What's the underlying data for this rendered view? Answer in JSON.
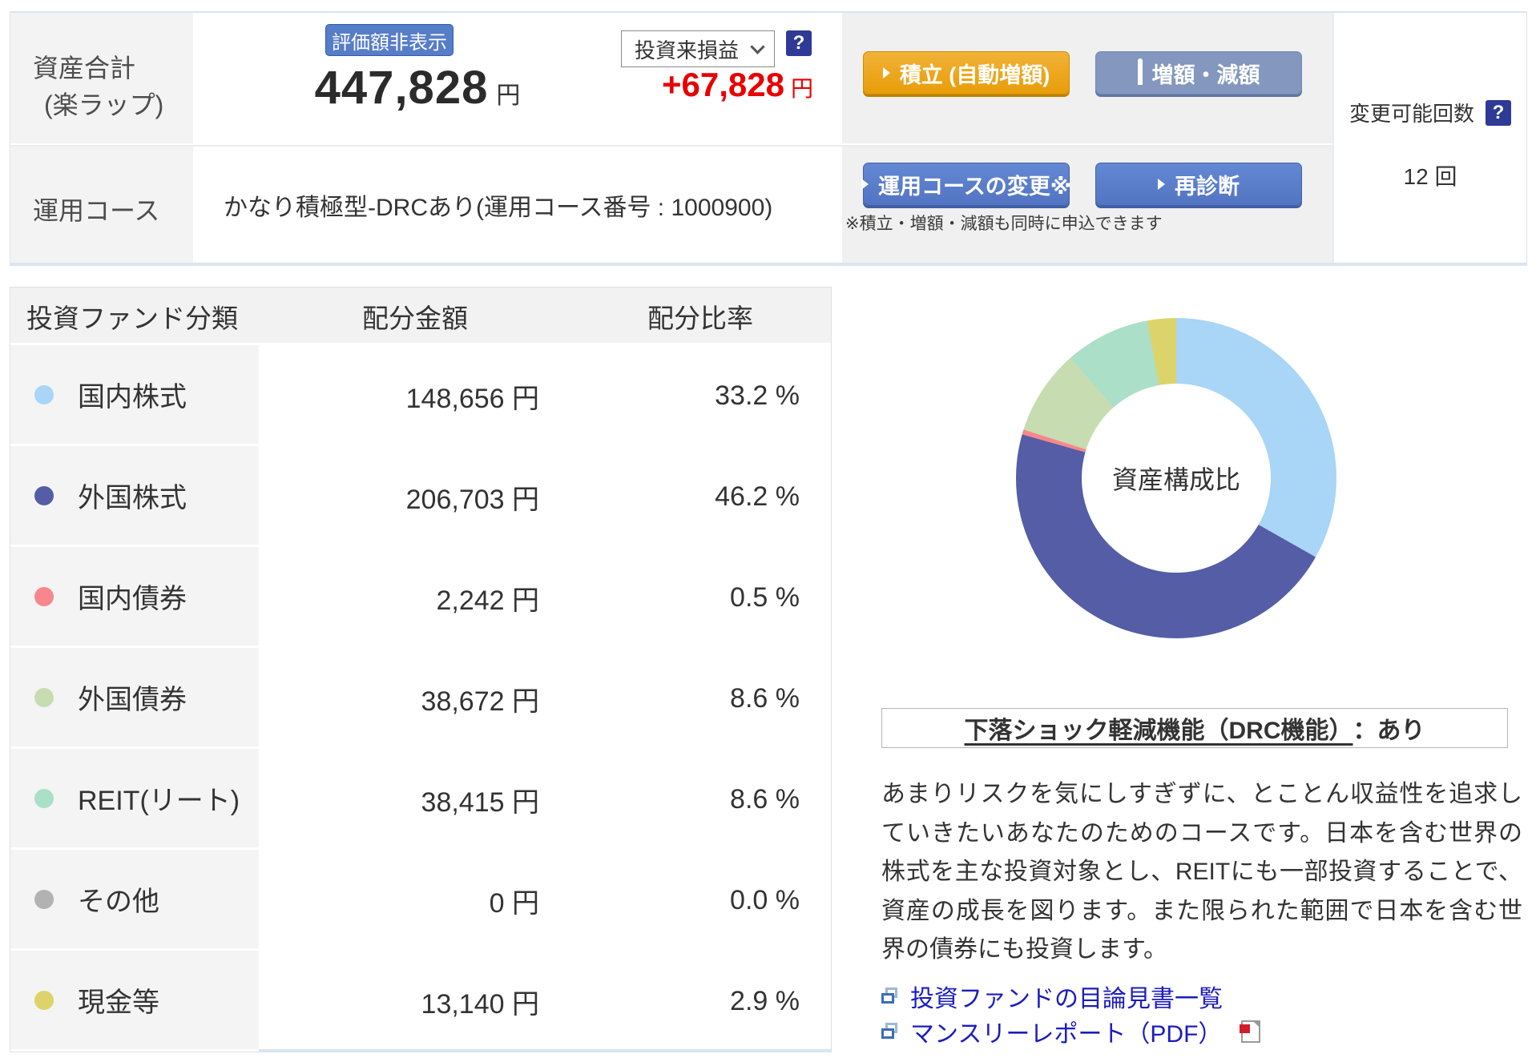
{
  "summary": {
    "asset_total_label": "資産合計",
    "asset_total_sublabel": "(楽ラップ)",
    "hide_value_button": "評価額非表示",
    "total_amount": "447,828",
    "total_unit": "円",
    "pl_dropdown_value": "投資来損益",
    "pl_amount": "+67,828",
    "pl_unit": "円",
    "help_icon_glyph": "?",
    "tsumitate_button": "積立 (自動増額)",
    "zougen_button": "増額・減額",
    "course_label": "運用コース",
    "course_value": "かなり積極型-DRCあり(運用コース番号 : 1000900)",
    "course_change_button": "運用コースの変更※",
    "rediagnosis_button": "再診断",
    "note": "※積立・増額・減額も同時に申込できます",
    "change_count_label": "変更可能回数",
    "change_count_value": "12 回"
  },
  "table": {
    "headers": {
      "category": "投資ファンド分類",
      "amount": "配分金額",
      "ratio": "配分比率"
    },
    "rows": [
      {
        "label": "国内株式",
        "amount": "148,656 円",
        "ratio": "33.2 %",
        "color": "#a9d5f6"
      },
      {
        "label": "外国株式",
        "amount": "206,703 円",
        "ratio": "46.2 %",
        "color": "#545da6"
      },
      {
        "label": "国内債券",
        "amount": "2,242 円",
        "ratio": "0.5 %",
        "color": "#f7878d"
      },
      {
        "label": "外国債券",
        "amount": "38,672 円",
        "ratio": "8.6 %",
        "color": "#c8dcb2"
      },
      {
        "label": "REIT(リート)",
        "amount": "38,415 円",
        "ratio": "8.6 %",
        "color": "#abdfc8"
      },
      {
        "label": "その他",
        "amount": "0 円",
        "ratio": "0.0 %",
        "color": "#b2b2b2"
      },
      {
        "label": "現金等",
        "amount": "13,140 円",
        "ratio": "2.9 %",
        "color": "#dcd46a"
      }
    ]
  },
  "chart_data": {
    "type": "pie",
    "title": "資産構成比",
    "center_label": "資産構成比",
    "categories": [
      "国内株式",
      "外国株式",
      "国内債券",
      "外国債券",
      "REIT(リート)",
      "その他",
      "現金等"
    ],
    "values": [
      33.2,
      46.2,
      0.5,
      8.6,
      8.6,
      0.0,
      2.9
    ],
    "unit": "%",
    "colors": [
      "#a9d5f6",
      "#545da6",
      "#f7878d",
      "#c8dcb2",
      "#abdfc8",
      "#b2b2b2",
      "#dcd46a"
    ],
    "start_angle_deg": 0,
    "direction": "clockwise",
    "donut": true
  },
  "drc": {
    "title_underlined": "下落ショック軽減機能（DRC機能）",
    "title_suffix": "：あり"
  },
  "description": "あまりリスクを気にしすぎずに、とことん収益性を追求していきたいあなたのためのコースです。日本を含む世界の株式を主な投資対象とし、REITにも一部投資することで、資産の成長を図ります。また限られた範囲で日本を含む世界の債券にも投資します。",
  "links": [
    {
      "label": "投資ファンドの目論見書一覧"
    },
    {
      "label": "マンスリーレポート（PDF）"
    }
  ]
}
